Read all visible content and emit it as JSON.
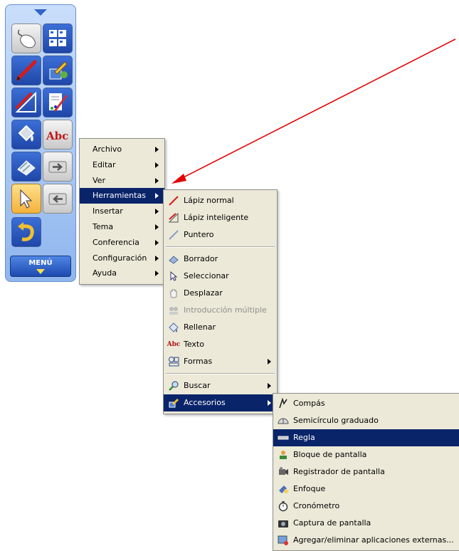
{
  "toolbar": {
    "menu_label": "MENÚ",
    "tools": [
      {
        "name": "mouse-tool-icon"
      },
      {
        "name": "page-sorter-icon"
      },
      {
        "name": "pen-tool-icon"
      },
      {
        "name": "accessories-tool-icon"
      },
      {
        "name": "smart-pen-icon"
      },
      {
        "name": "creative-pen-icon"
      },
      {
        "name": "fill-tool-icon"
      },
      {
        "name": "text-tool-icon"
      },
      {
        "name": "eraser-tool-icon"
      },
      {
        "name": "next-page-icon"
      },
      {
        "name": "select-tool-icon"
      },
      {
        "name": "previous-page-icon"
      },
      {
        "name": "undo-icon"
      }
    ]
  },
  "main_menu": {
    "items": [
      {
        "label": "Archivo",
        "submenu": true
      },
      {
        "label": "Editar",
        "submenu": true
      },
      {
        "label": "Ver",
        "submenu": true
      },
      {
        "label": "Herramientas",
        "submenu": true,
        "selected": true
      },
      {
        "label": "Insertar",
        "submenu": true
      },
      {
        "label": "Tema",
        "submenu": true
      },
      {
        "label": "Conferencia",
        "submenu": true
      },
      {
        "label": "Configuración",
        "submenu": true
      },
      {
        "label": "Ayuda",
        "submenu": true
      }
    ]
  },
  "tools_menu": {
    "items": [
      {
        "label": "Lápiz normal",
        "icon": "pen-icon"
      },
      {
        "label": "Lápiz inteligente",
        "icon": "smart-pen-icon"
      },
      {
        "label": "Puntero",
        "icon": "pointer-icon"
      },
      {
        "label": "Borrador",
        "icon": "eraser-icon"
      },
      {
        "label": "Seleccionar",
        "icon": "select-arrow-icon"
      },
      {
        "label": "Desplazar",
        "icon": "hand-icon"
      },
      {
        "label": "Introducción múltiple",
        "icon": "multi-input-icon",
        "disabled": true
      },
      {
        "label": "Rellenar",
        "icon": "fill-bucket-icon"
      },
      {
        "label": "Texto",
        "icon": "text-abc-icon"
      },
      {
        "label": "Formas",
        "icon": "shapes-icon",
        "submenu": true
      },
      {
        "label": "Buscar",
        "icon": "search-icon",
        "submenu": true
      },
      {
        "label": "Accesorios",
        "icon": "accessories-icon",
        "submenu": true,
        "selected": true
      }
    ]
  },
  "accessories_menu": {
    "items": [
      {
        "label": "Compás",
        "icon": "compass-icon"
      },
      {
        "label": "Semicírculo graduado",
        "icon": "protractor-icon"
      },
      {
        "label": "Regla",
        "icon": "ruler-icon",
        "selected": true
      },
      {
        "label": "Bloque de pantalla",
        "icon": "screen-block-icon"
      },
      {
        "label": "Registrador de pantalla",
        "icon": "screen-recorder-icon"
      },
      {
        "label": "Enfoque",
        "icon": "spotlight-icon"
      },
      {
        "label": "Cronómetro",
        "icon": "stopwatch-icon"
      },
      {
        "label": "Captura de pantalla",
        "icon": "camera-icon"
      },
      {
        "label": "Agregar/eliminar aplicaciones externas...",
        "icon": "add-remove-apps-icon"
      }
    ]
  },
  "colors": {
    "menu_bg": "#ece9d8",
    "selection": "#0a246a",
    "annotation_arrow": "#e30000"
  }
}
